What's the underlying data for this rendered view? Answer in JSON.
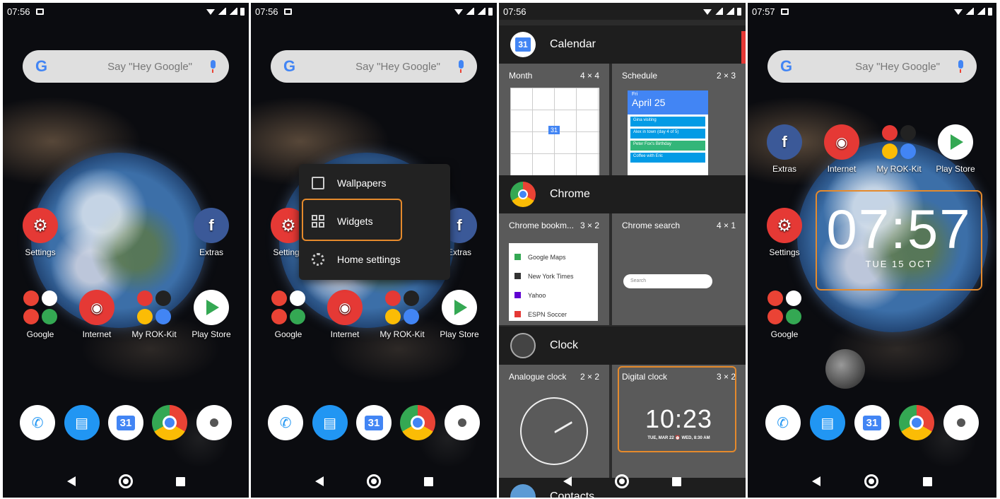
{
  "status": {
    "time1": "07:56",
    "time2": "07:56",
    "time3": "07:56",
    "time4": "07:57"
  },
  "search": {
    "hint": "Say \"Hey Google\"",
    "logo": "G"
  },
  "apps": {
    "settings": "Settings",
    "extras": "Extras",
    "google": "Google",
    "internet": "Internet",
    "rokkit": "My ROK-Kit",
    "playstore": "Play Store"
  },
  "icons": {
    "settings": "⚙",
    "extras": "f",
    "internet": "◉",
    "calendar_day": "31"
  },
  "menu": {
    "wallpapers": "Wallpapers",
    "widgets": "Widgets",
    "home_settings": "Home settings"
  },
  "widgets": {
    "calendar": {
      "title": "Calendar",
      "month_label": "Month",
      "month_size": "4 × 4",
      "schedule_label": "Schedule",
      "schedule_size": "2 × 3",
      "schedule_day": "Fri",
      "schedule_date": "April 25",
      "events": [
        "Gina visiting",
        "Alex in town (day 4 of 5)",
        "Peter Fox's Birthday",
        "Coffee with Eric"
      ]
    },
    "chrome": {
      "title": "Chrome",
      "bookmarks_label": "Chrome bookm...",
      "bookmarks_size": "3 × 2",
      "search_label": "Chrome search",
      "search_size": "4 × 1",
      "search_placeholder": "Search",
      "bookmarks": [
        "Google Maps",
        "New York Times",
        "Yahoo",
        "ESPN Soccer"
      ]
    },
    "clock": {
      "title": "Clock",
      "analogue_label": "Analogue clock",
      "analogue_size": "2 × 2",
      "digital_label": "Digital clock",
      "digital_size": "3 × 2",
      "digital_time": "10:23",
      "digital_date": "TUE, MAR 22 ⏰ WED, 8:30 AM"
    },
    "contacts": {
      "title": "Contacts"
    }
  },
  "home_clock": {
    "time": "07:57",
    "date": "TUE 15 OCT"
  },
  "colors": {
    "highlight": "#e58a2c",
    "accent": "#4285f4"
  }
}
